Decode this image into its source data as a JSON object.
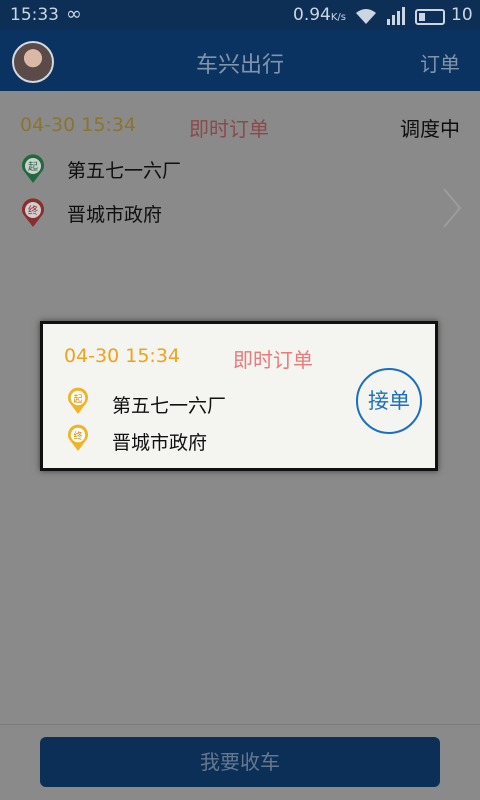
{
  "status_bar": {
    "time": "15:33",
    "speed": "0.94",
    "speed_unit": "K/s",
    "battery": "10"
  },
  "header": {
    "title": "车兴出行",
    "orders_link": "订单"
  },
  "order": {
    "time": "04-30 15:34",
    "type": "即时订单",
    "status": "调度中",
    "start_marker": "起",
    "end_marker": "终",
    "start": "第五七一六厂",
    "end": "晋城市政府"
  },
  "dialog": {
    "time": "04-30 15:34",
    "type": "即时订单",
    "start_marker": "起",
    "end_marker": "终",
    "start": "第五七一六厂",
    "end": "晋城市政府",
    "accept_label": "接单"
  },
  "footer": {
    "button_label": "我要收车"
  },
  "colors": {
    "header_bg": "#0b3361",
    "dim_overlay_bg": "#8a8a8a",
    "dialog_time": "#f0a21c",
    "dialog_type": "#ec7a7a",
    "accept": "#1a6fc0",
    "start_pin": "#1f8a4c",
    "end_pin": "#b23a3a",
    "dialog_pin": "#f0b429"
  },
  "icons": {
    "infinity": "infinity-icon",
    "wifi": "wifi-icon",
    "signal": "signal-icon",
    "battery": "battery-icon",
    "avatar": "avatar",
    "chevron": "chevron-right-icon",
    "pin": "map-pin-icon"
  }
}
